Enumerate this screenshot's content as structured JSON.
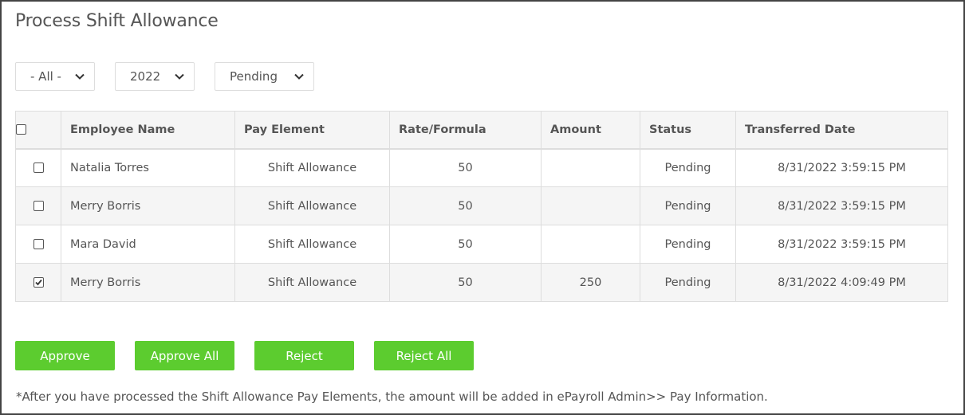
{
  "page": {
    "title": "Process Shift Allowance"
  },
  "filters": [
    {
      "value": "- All -"
    },
    {
      "value": "2022"
    },
    {
      "value": "Pending"
    }
  ],
  "table": {
    "headers": [
      "Employee Name",
      "Pay Element",
      "Rate/Formula",
      "Amount",
      "Status",
      "Transferred Date"
    ],
    "rows": [
      {
        "checked": false,
        "employee": "Natalia Torres",
        "pay_element": "Shift Allowance",
        "rate": "50",
        "amount": "",
        "status": "Pending",
        "date": "8/31/2022 3:59:15 PM"
      },
      {
        "checked": false,
        "employee": "Merry Borris",
        "pay_element": "Shift Allowance",
        "rate": "50",
        "amount": "",
        "status": "Pending",
        "date": "8/31/2022 3:59:15 PM"
      },
      {
        "checked": false,
        "employee": "Mara David",
        "pay_element": "Shift Allowance",
        "rate": "50",
        "amount": "",
        "status": "Pending",
        "date": "8/31/2022 3:59:15 PM"
      },
      {
        "checked": true,
        "employee": "Merry Borris",
        "pay_element": "Shift Allowance",
        "rate": "50",
        "amount": "250",
        "status": "Pending",
        "date": "8/31/2022 4:09:49 PM"
      }
    ]
  },
  "buttons": {
    "approve": "Approve",
    "approve_all": "Approve All",
    "reject": "Reject",
    "reject_all": "Reject All"
  },
  "note": "*After you have processed the Shift Allowance Pay Elements, the amount will be added in ePayroll Admin>> Pay Information.",
  "colors": {
    "button": "#5ccc2f",
    "text": "#555555",
    "border": "#dddddd"
  }
}
